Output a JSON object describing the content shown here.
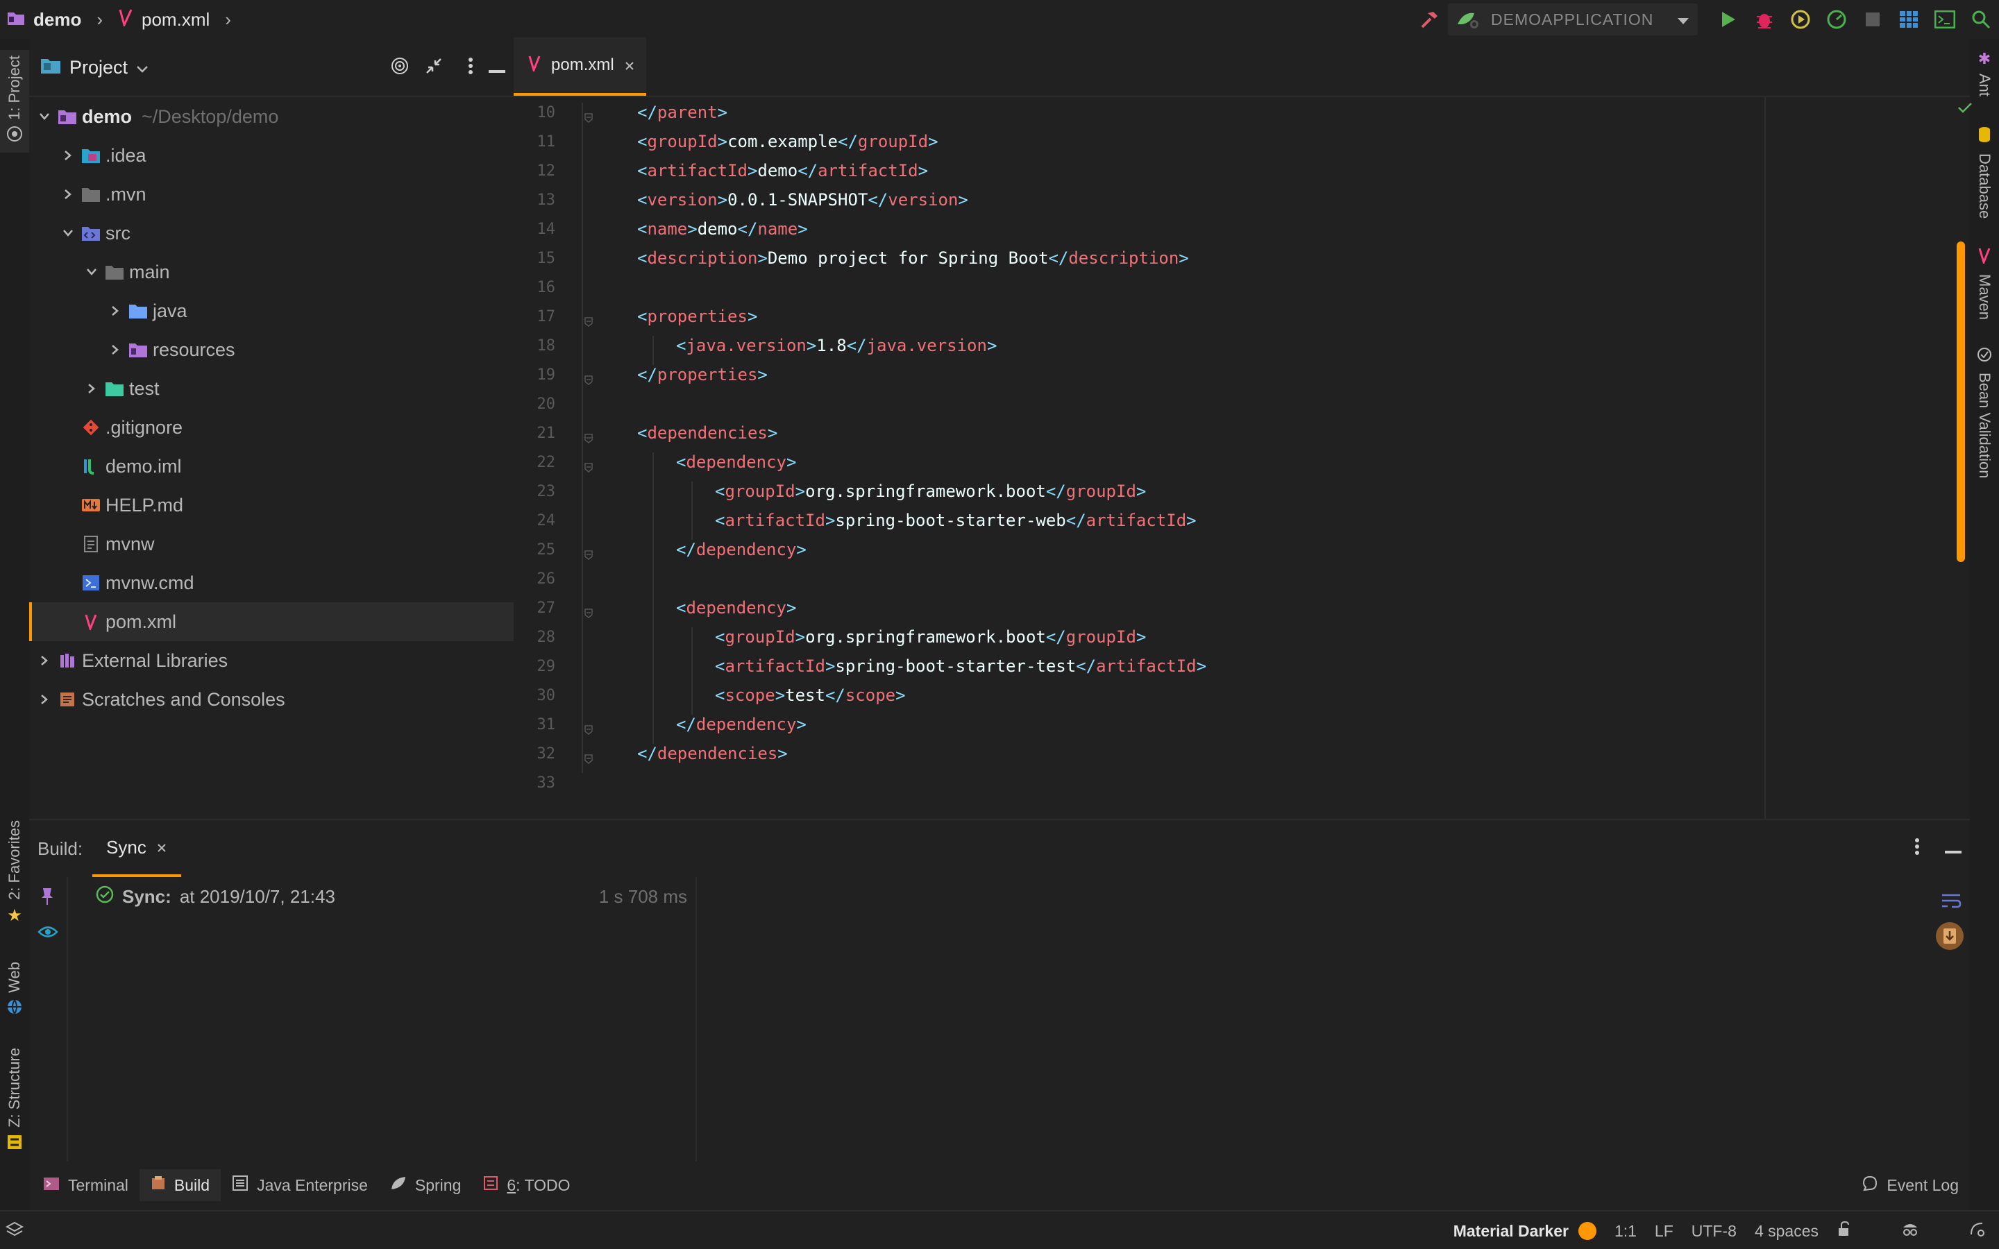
{
  "colors": {
    "accent": "#ff9800",
    "tag": "#f07178",
    "bracket": "#89ddff",
    "text": "#eeffff"
  },
  "breadcrumb": {
    "project": "demo",
    "file": "pom.xml"
  },
  "run_config": {
    "label": "DEMOAPPLICATION"
  },
  "project_panel": {
    "title": "Project",
    "tree": [
      {
        "label": "demo",
        "path": "~/Desktop/demo",
        "icon": "module-folder-icon"
      },
      {
        "label": ".idea",
        "icon": "idea-folder-icon"
      },
      {
        "label": ".mvn",
        "icon": "folder-icon"
      },
      {
        "label": "src",
        "icon": "source-folder-icon"
      },
      {
        "label": "main",
        "icon": "folder-icon"
      },
      {
        "label": "java",
        "icon": "java-folder-icon"
      },
      {
        "label": "resources",
        "icon": "resources-folder-icon"
      },
      {
        "label": "test",
        "icon": "test-folder-icon"
      },
      {
        "label": ".gitignore",
        "icon": "git-icon"
      },
      {
        "label": "demo.iml",
        "icon": "iml-icon"
      },
      {
        "label": "HELP.md",
        "icon": "markdown-icon"
      },
      {
        "label": "mvnw",
        "icon": "text-file-icon"
      },
      {
        "label": "mvnw.cmd",
        "icon": "cmd-file-icon"
      },
      {
        "label": "pom.xml",
        "icon": "maven-icon"
      },
      {
        "label": "External Libraries",
        "icon": "library-icon"
      },
      {
        "label": "Scratches and Consoles",
        "icon": "scratches-icon"
      }
    ]
  },
  "editor": {
    "tab": "pom.xml",
    "lines": [
      {
        "n": "10",
        "indent": 1,
        "parts": [
          [
            "b",
            "</"
          ],
          [
            "t",
            "parent"
          ],
          [
            "b",
            ">"
          ]
        ]
      },
      {
        "n": "11",
        "indent": 1,
        "parts": [
          [
            "b",
            "<"
          ],
          [
            "t",
            "groupId"
          ],
          [
            "b",
            ">"
          ],
          [
            "p",
            "com.example"
          ],
          [
            "b",
            "</"
          ],
          [
            "t",
            "groupId"
          ],
          [
            "b",
            ">"
          ]
        ]
      },
      {
        "n": "12",
        "indent": 1,
        "parts": [
          [
            "b",
            "<"
          ],
          [
            "t",
            "artifactId"
          ],
          [
            "b",
            ">"
          ],
          [
            "p",
            "demo"
          ],
          [
            "b",
            "</"
          ],
          [
            "t",
            "artifactId"
          ],
          [
            "b",
            ">"
          ]
        ]
      },
      {
        "n": "13",
        "indent": 1,
        "parts": [
          [
            "b",
            "<"
          ],
          [
            "t",
            "version"
          ],
          [
            "b",
            ">"
          ],
          [
            "p",
            "0.0.1-SNAPSHOT"
          ],
          [
            "b",
            "</"
          ],
          [
            "t",
            "version"
          ],
          [
            "b",
            ">"
          ]
        ]
      },
      {
        "n": "14",
        "indent": 1,
        "parts": [
          [
            "b",
            "<"
          ],
          [
            "t",
            "name"
          ],
          [
            "b",
            ">"
          ],
          [
            "p",
            "demo"
          ],
          [
            "b",
            "</"
          ],
          [
            "t",
            "name"
          ],
          [
            "b",
            ">"
          ]
        ]
      },
      {
        "n": "15",
        "indent": 1,
        "parts": [
          [
            "b",
            "<"
          ],
          [
            "t",
            "description"
          ],
          [
            "b",
            ">"
          ],
          [
            "p",
            "Demo project for Spring Boot"
          ],
          [
            "b",
            "</"
          ],
          [
            "t",
            "description"
          ],
          [
            "b",
            ">"
          ]
        ]
      },
      {
        "n": "16",
        "indent": 0,
        "parts": []
      },
      {
        "n": "17",
        "indent": 1,
        "parts": [
          [
            "b",
            "<"
          ],
          [
            "t",
            "properties"
          ],
          [
            "b",
            ">"
          ]
        ]
      },
      {
        "n": "18",
        "indent": 2,
        "parts": [
          [
            "b",
            "<"
          ],
          [
            "t",
            "java.version"
          ],
          [
            "b",
            ">"
          ],
          [
            "p",
            "1.8"
          ],
          [
            "b",
            "</"
          ],
          [
            "t",
            "java.version"
          ],
          [
            "b",
            ">"
          ]
        ]
      },
      {
        "n": "19",
        "indent": 1,
        "parts": [
          [
            "b",
            "</"
          ],
          [
            "t",
            "properties"
          ],
          [
            "b",
            ">"
          ]
        ]
      },
      {
        "n": "20",
        "indent": 0,
        "parts": []
      },
      {
        "n": "21",
        "indent": 1,
        "parts": [
          [
            "b",
            "<"
          ],
          [
            "t",
            "dependencies"
          ],
          [
            "b",
            ">"
          ]
        ]
      },
      {
        "n": "22",
        "indent": 2,
        "parts": [
          [
            "b",
            "<"
          ],
          [
            "t",
            "dependency"
          ],
          [
            "b",
            ">"
          ]
        ]
      },
      {
        "n": "23",
        "indent": 3,
        "parts": [
          [
            "b",
            "<"
          ],
          [
            "t",
            "groupId"
          ],
          [
            "b",
            ">"
          ],
          [
            "p",
            "org.springframework.boot"
          ],
          [
            "b",
            "</"
          ],
          [
            "t",
            "groupId"
          ],
          [
            "b",
            ">"
          ]
        ]
      },
      {
        "n": "24",
        "indent": 3,
        "parts": [
          [
            "b",
            "<"
          ],
          [
            "t",
            "artifactId"
          ],
          [
            "b",
            ">"
          ],
          [
            "p",
            "spring-boot-starter-web"
          ],
          [
            "b",
            "</"
          ],
          [
            "t",
            "artifactId"
          ],
          [
            "b",
            ">"
          ]
        ]
      },
      {
        "n": "25",
        "indent": 2,
        "parts": [
          [
            "b",
            "</"
          ],
          [
            "t",
            "dependency"
          ],
          [
            "b",
            ">"
          ]
        ]
      },
      {
        "n": "26",
        "indent": 0,
        "parts": []
      },
      {
        "n": "27",
        "indent": 2,
        "parts": [
          [
            "b",
            "<"
          ],
          [
            "t",
            "dependency"
          ],
          [
            "b",
            ">"
          ]
        ]
      },
      {
        "n": "28",
        "indent": 3,
        "parts": [
          [
            "b",
            "<"
          ],
          [
            "t",
            "groupId"
          ],
          [
            "b",
            ">"
          ],
          [
            "p",
            "org.springframework.boot"
          ],
          [
            "b",
            "</"
          ],
          [
            "t",
            "groupId"
          ],
          [
            "b",
            ">"
          ]
        ]
      },
      {
        "n": "29",
        "indent": 3,
        "parts": [
          [
            "b",
            "<"
          ],
          [
            "t",
            "artifactId"
          ],
          [
            "b",
            ">"
          ],
          [
            "p",
            "spring-boot-starter-test"
          ],
          [
            "b",
            "</"
          ],
          [
            "t",
            "artifactId"
          ],
          [
            "b",
            ">"
          ]
        ]
      },
      {
        "n": "30",
        "indent": 3,
        "parts": [
          [
            "b",
            "<"
          ],
          [
            "t",
            "scope"
          ],
          [
            "b",
            ">"
          ],
          [
            "p",
            "test"
          ],
          [
            "b",
            "</"
          ],
          [
            "t",
            "scope"
          ],
          [
            "b",
            ">"
          ]
        ]
      },
      {
        "n": "31",
        "indent": 2,
        "parts": [
          [
            "b",
            "</"
          ],
          [
            "t",
            "dependency"
          ],
          [
            "b",
            ">"
          ]
        ]
      },
      {
        "n": "32",
        "indent": 1,
        "parts": [
          [
            "b",
            "</"
          ],
          [
            "t",
            "dependencies"
          ],
          [
            "b",
            ">"
          ]
        ]
      },
      {
        "n": "33",
        "indent": 0,
        "parts": []
      }
    ]
  },
  "left_tabs": {
    "project": "1: Project",
    "favorites": "2: Favorites",
    "web": "Web",
    "structure": "Z: Structure"
  },
  "right_tabs": {
    "ant": "Ant",
    "database": "Database",
    "maven": "Maven",
    "bean_validation": "Bean Validation"
  },
  "build_panel": {
    "label": "Build:",
    "tab": "Sync",
    "sync_title": "Sync:",
    "sync_time": "at 2019/10/7, 21:43",
    "duration": "1 s 708 ms"
  },
  "bottom_tools": {
    "terminal": "Terminal",
    "build": "Build",
    "java_enterprise": "Java Enterprise",
    "spring": "Spring",
    "todo_num": "6",
    "todo": ": TODO",
    "event_log": "Event Log"
  },
  "status": {
    "theme": "Material Darker",
    "position": "1:1",
    "line_sep": "LF",
    "encoding": "UTF-8",
    "indent": "4 spaces"
  }
}
